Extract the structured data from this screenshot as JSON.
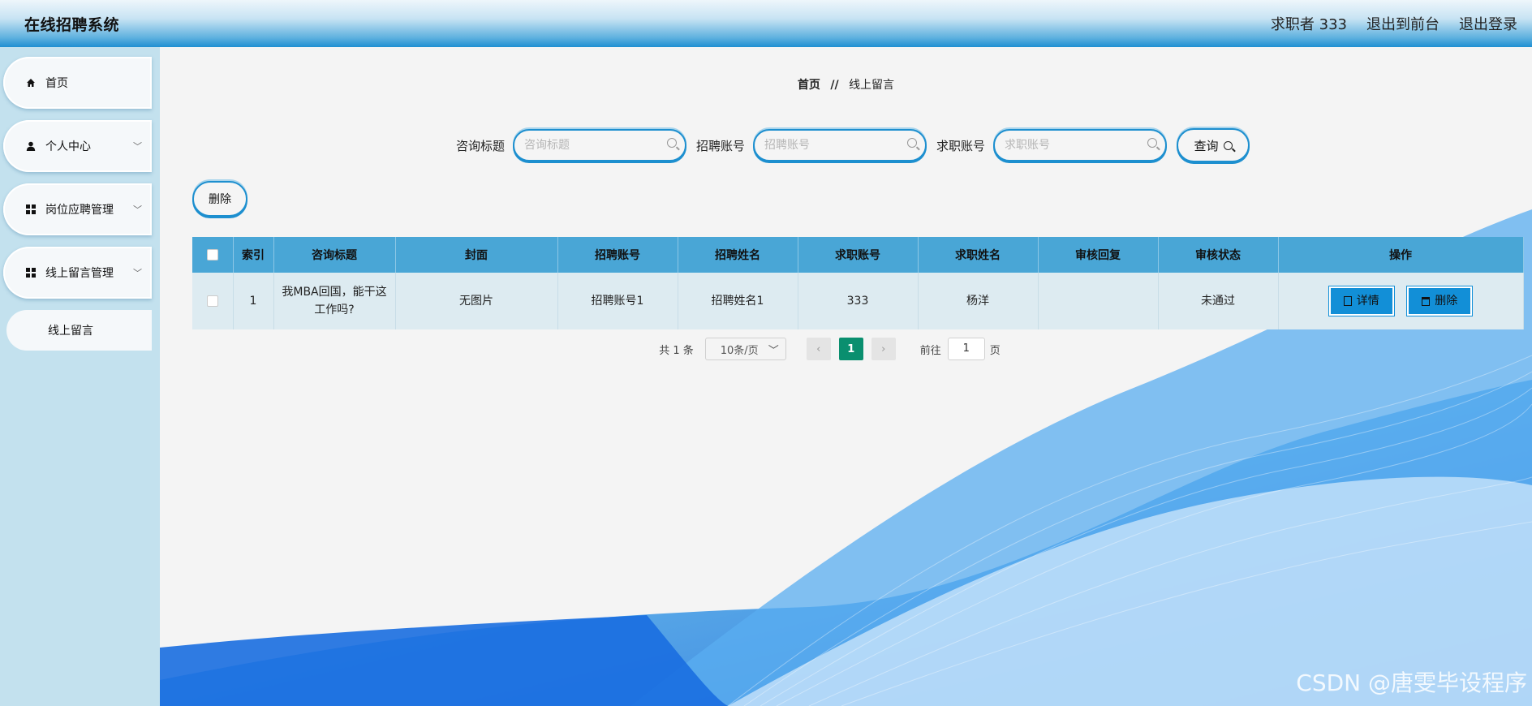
{
  "header": {
    "app_title": "在线招聘系统",
    "user_label": "求职者 333",
    "exit_front": "退出到前台",
    "logout": "退出登录"
  },
  "sidebar": {
    "items": [
      {
        "label": "首页",
        "icon": "home-icon"
      },
      {
        "label": "个人中心",
        "icon": "user-icon"
      },
      {
        "label": "岗位应聘管理",
        "icon": "grid-icon"
      },
      {
        "label": "线上留言管理",
        "icon": "grid-icon"
      }
    ],
    "sub_active": "线上留言"
  },
  "breadcrumb": {
    "home": "首页",
    "sep": "//",
    "current": "线上留言"
  },
  "search": {
    "field1_label": "咨询标题",
    "field1_placeholder": "咨询标题",
    "field2_label": "招聘账号",
    "field2_placeholder": "招聘账号",
    "field3_label": "求职账号",
    "field3_placeholder": "求职账号",
    "query_label": "查询"
  },
  "toolbar": {
    "delete_label": "删除"
  },
  "table": {
    "headers": [
      "索引",
      "咨询标题",
      "封面",
      "招聘账号",
      "招聘姓名",
      "求职账号",
      "求职姓名",
      "审核回复",
      "审核状态",
      "操作"
    ],
    "rows": [
      {
        "index": "1",
        "title": "我MBA回国，能干这工作吗?",
        "cover": "无图片",
        "recruit_account": "招聘账号1",
        "recruit_name": "招聘姓名1",
        "seeker_account": "333",
        "seeker_name": "杨洋",
        "reply": "",
        "status": "未通过",
        "detail_label": "详情",
        "delete_label": "删除"
      }
    ]
  },
  "pagination": {
    "total": "共 1 条",
    "page_size": "10条/页",
    "current": "1",
    "goto": "前往",
    "goto_value": "1",
    "page_unit": "页"
  },
  "watermark": "CSDN @唐雯毕设程序",
  "colors": {
    "accent": "#1d8fcf",
    "header_blue": "#49a6d6",
    "page_active": "#0a8f6f"
  }
}
